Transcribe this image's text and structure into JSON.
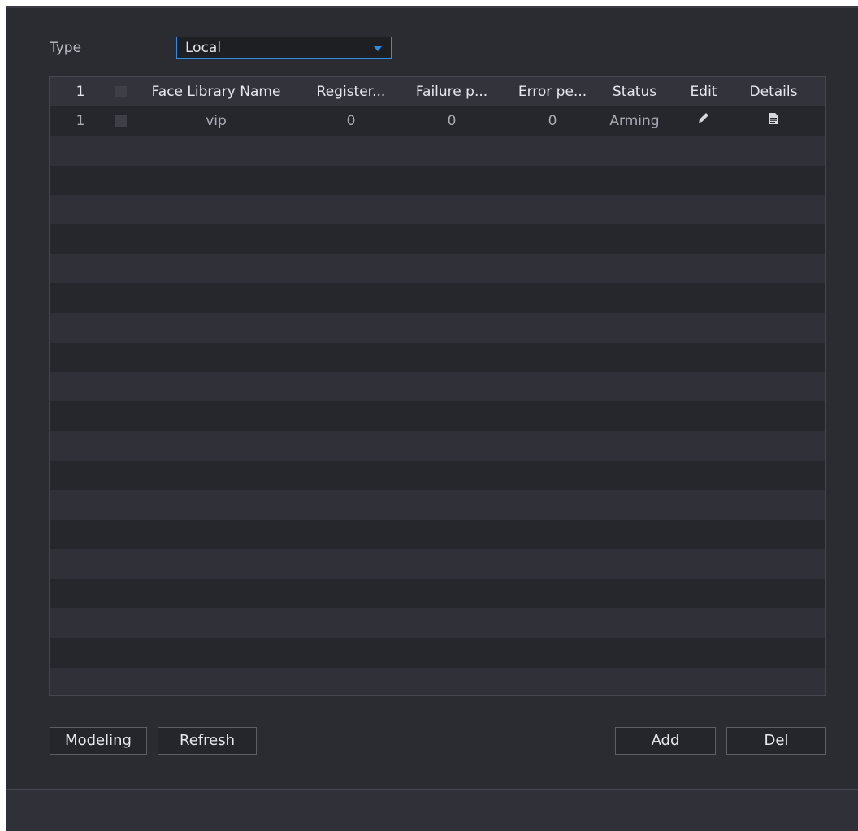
{
  "filter": {
    "type_label": "Type",
    "type_value": "Local"
  },
  "table": {
    "headers": {
      "index": "1",
      "name": "Face Library Name",
      "registered": "Register...",
      "failure": "Failure p...",
      "error": "Error pe...",
      "status": "Status",
      "edit": "Edit",
      "details": "Details"
    },
    "rows": [
      {
        "index": "1",
        "name": "vip",
        "registered": "0",
        "failure": "0",
        "error": "0",
        "status": "Arming"
      }
    ],
    "empty_rows": 19
  },
  "buttons": {
    "modeling": "Modeling",
    "refresh": "Refresh",
    "add": "Add",
    "del": "Del"
  },
  "icons": {
    "edit": "pencil-icon",
    "details": "document-icon"
  },
  "colors": {
    "accent": "#2f8de4",
    "panel": "#2b2c32"
  }
}
